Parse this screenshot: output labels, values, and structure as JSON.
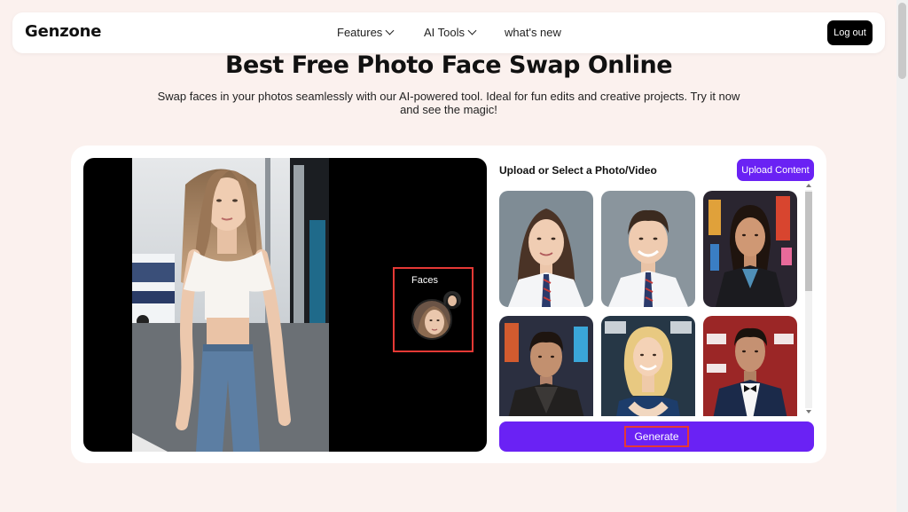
{
  "nav": {
    "logo": "Genzone",
    "items": [
      {
        "label": "Features",
        "has_dropdown": true
      },
      {
        "label": "AI Tools",
        "has_dropdown": true
      },
      {
        "label": "what's new",
        "has_dropdown": false
      }
    ],
    "logout_label": "Log out"
  },
  "hero": {
    "title": "Best Free Photo Face Swap Online",
    "subtitle": "Swap faces in your photos seamlessly with our AI-powered tool. Ideal for fun edits and creative projects. Try it now and see the magic!"
  },
  "preview": {
    "faces_label": "Faces"
  },
  "panel": {
    "title": "Upload or Select a Photo/Video",
    "upload_label": "Upload Content",
    "generate_label": "Generate",
    "thumbnails": [
      {
        "name": "girl-school-uniform"
      },
      {
        "name": "boy-school-uniform"
      },
      {
        "name": "woman-city-night"
      },
      {
        "name": "man-leather-jacket"
      },
      {
        "name": "woman-sequin-dress"
      },
      {
        "name": "man-tuxedo"
      }
    ]
  },
  "colors": {
    "accent": "#6a22f4",
    "background": "#fbf1ee",
    "highlight": "#e53935"
  }
}
